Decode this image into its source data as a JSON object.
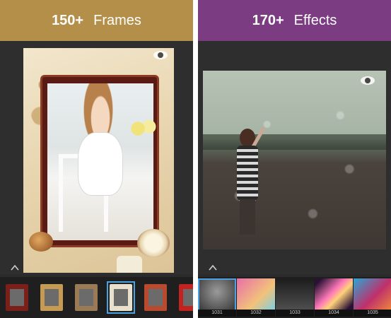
{
  "left_panel": {
    "banner": {
      "count": "150+",
      "label": "Frames",
      "color": "#b48f49"
    },
    "preview_icon": "eye-icon",
    "collapse_icon": "chevron-up-icon",
    "frame_thumbnails": [
      {
        "ring": "#7a1f1a",
        "selected": false
      },
      {
        "ring": "#c59a52",
        "selected": false
      },
      {
        "ring": "#9b7b55",
        "selected": false
      },
      {
        "ring": "#e8e0cc",
        "selected": true
      },
      {
        "ring": "#b84a30",
        "selected": false
      },
      {
        "ring": "#c4221e",
        "selected": false
      }
    ]
  },
  "right_panel": {
    "banner": {
      "count": "170+",
      "label": "Effects",
      "color": "#7b3c82"
    },
    "preview_icon": "eye-icon",
    "collapse_icon": "chevron-up-icon",
    "effect_thumbnails": [
      {
        "id": "1031",
        "selected": true
      },
      {
        "id": "1032",
        "selected": false
      },
      {
        "id": "1033",
        "selected": false
      },
      {
        "id": "1034",
        "selected": false
      },
      {
        "id": "1035",
        "selected": false
      }
    ]
  },
  "accent_colors": {
    "selection": "#4aa3e0",
    "dark_bg": "#2b2b2b"
  }
}
